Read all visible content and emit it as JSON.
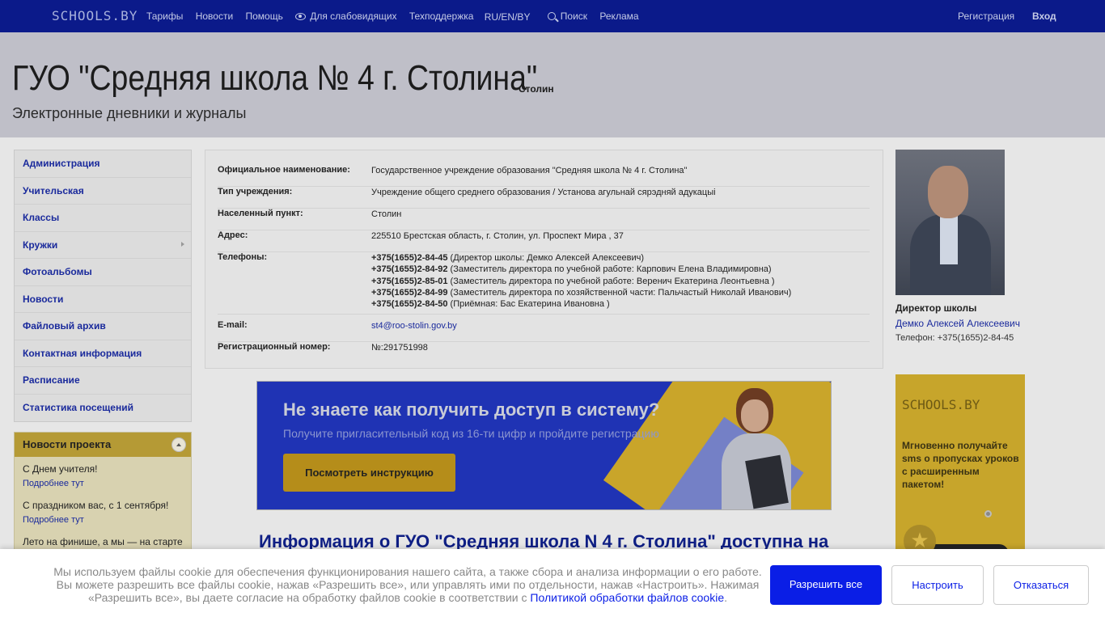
{
  "topbar": {
    "logo": "SCHOOLS.BY",
    "nav": [
      "Тарифы",
      "Новости",
      "Помощь",
      "Для слабовидящих",
      "Техподдержка",
      "RU/EN/BY",
      "Поиск",
      "Реклама"
    ],
    "register": "Регистрация",
    "login": "Вход"
  },
  "header": {
    "title": "ГУО \"Средняя школа № 4 г. Столина\"",
    "city": "Столин",
    "subtitle": "Электронные дневники и журналы"
  },
  "sidebar": {
    "items": [
      {
        "label": "Администрация"
      },
      {
        "label": "Учительская"
      },
      {
        "label": "Классы"
      },
      {
        "label": "Кружки"
      },
      {
        "label": "Фотоальбомы"
      },
      {
        "label": "Новости"
      },
      {
        "label": "Файловый архив"
      },
      {
        "label": "Контактная информация"
      },
      {
        "label": "Расписание"
      },
      {
        "label": "Статистика посещений"
      }
    ]
  },
  "news": {
    "title": "Новости проекта",
    "items": [
      {
        "text": "С Днем учителя!",
        "link": "Подробнее тут"
      },
      {
        "text": "С праздником вас, с 1 сентября!",
        "link": "Подробнее тут"
      },
      {
        "text": "Лето на финише, а мы — на старте",
        "link": ""
      }
    ]
  },
  "info": {
    "official_name": {
      "label": "Официальное наименование:",
      "value": "Государственное учреждение образования \"Средняя школа № 4 г. Столина\""
    },
    "type": {
      "label": "Тип учреждения:",
      "value": "Учреждение общего среднего образования / Установа агульнай сярэдняй адукацыі"
    },
    "locality": {
      "label": "Населенный пункт:",
      "value": "Столин"
    },
    "address": {
      "label": "Адрес:",
      "value": "225510 Брестская область, г. Столин, ул. Проспект Мира , 37"
    },
    "phones": {
      "label": "Телефоны:",
      "items": [
        {
          "number": "+375(1655)2-84-45",
          "desc": " (Директор школы: Демко Алексей Алексеевич)"
        },
        {
          "number": "+375(1655)2-84-92",
          "desc": " (Заместитель директора по учебной работе: Карпович Елена Владимировна)"
        },
        {
          "number": "+375(1655)2-85-01",
          "desc": " (Заместитель директора по учебной работе: Веренич Екатерина Леонтьевна )"
        },
        {
          "number": "+375(1655)2-84-99",
          "desc": " (Заместитель директора по хозяйственной части: Пальчастый Николай Иванович)"
        },
        {
          "number": "+375(1655)2-84-50",
          "desc": " (Приёмная: Бас Екатерина Ивановна )"
        }
      ]
    },
    "email": {
      "label": "E-mail:",
      "value": "st4@roo-stolin.gov.by"
    },
    "reg_number": {
      "label": "Регистрационный номер:",
      "value": "№:291751998"
    }
  },
  "director": {
    "label": "Директор школы",
    "name": "Демко Алексей Алексеевич",
    "phone": "Телефон: +375(1655)2-84-45"
  },
  "banner": {
    "heading": "Не знаете как получить доступ в систему?",
    "sub": "Получите пригласительный код из 16-ти цифр и пройдите регистрацию",
    "button": "Посмотреть инструкцию"
  },
  "info_heading": "Информация о ГУО \"Средняя школа N 4 г. Столина\" доступна на",
  "ad": {
    "logo": "SCHOOLS.BY",
    "text": "Мгновенно получайте sms о пропусках уроков с расширенным пакетом!"
  },
  "cookie": {
    "text": "Мы используем файлы cookie для обеспечения функционирования нашего сайта, а также сбора и анализа информации о его работе. Вы можете разрешить все файлы cookie, нажав «Разрешить все», или управлять ими по отдельности, нажав «Настроить». Нажимая «Разрешить все», вы даете согласие на обработку файлов cookie в соответствии с ",
    "link": "Политикой обработки файлов cookie",
    "suffix": ".",
    "allow": "Разрешить все",
    "settings": "Настроить",
    "deny": "Отказаться"
  },
  "colors": {
    "topbar": "#0b1a8a",
    "accent_blue": "#0a1ee6",
    "gold": "#c7a52b"
  }
}
